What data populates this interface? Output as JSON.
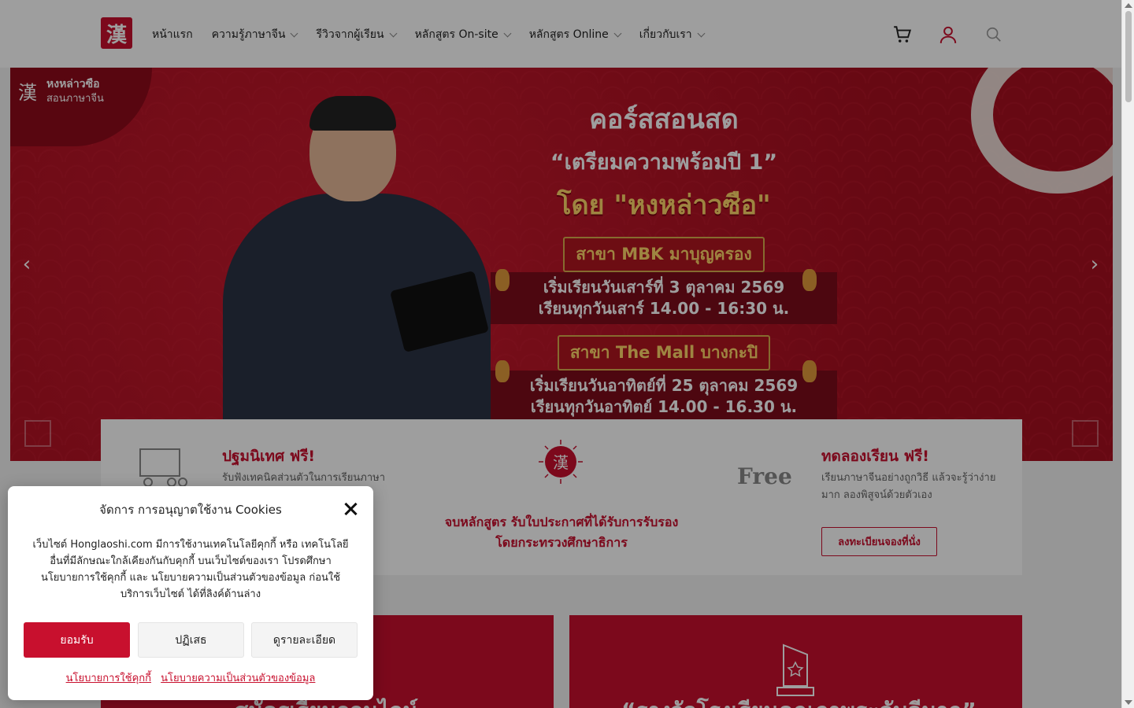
{
  "header": {
    "logo_glyph": "漢",
    "nav": [
      {
        "label": "หน้าแรก",
        "has_dropdown": false
      },
      {
        "label": "ความรู้ภาษาจีน",
        "has_dropdown": true
      },
      {
        "label": "รีวิวจากผู้เรียน",
        "has_dropdown": true
      },
      {
        "label": "หลักสูตร On-site",
        "has_dropdown": true
      },
      {
        "label": "หลักสูตร Online",
        "has_dropdown": true
      },
      {
        "label": "เกี่ยวกับเรา",
        "has_dropdown": true
      }
    ],
    "icons": [
      "cart-icon",
      "user-icon",
      "search-icon"
    ]
  },
  "hero": {
    "badge_name": "หงหล่าวซือ",
    "badge_sub": "สอนภาษาจีน",
    "title": "คอร์สสอนสด",
    "subtitle": "“เตรียมความพร้อมปี 1”",
    "by_line": "โดย \"หงหล่าวซือ\"",
    "branches": [
      {
        "name": "สาขา MBK มาบุญครอง",
        "line1": "เริ่มเรียนวันเสาร์ที่ 3 ตุลาคม 2569",
        "line2": "เรียนทุกวันเสาร์ 14.00 - 16:30 น."
      },
      {
        "name": "สาขา The Mall บางกะปิ",
        "line1": "เริ่มเรียนวันอาทิตย์ที่ 25 ตุลาคม 2569",
        "line2": "เรียนทุกวันอาทิตย์ 14.00 - 16.30 น."
      }
    ],
    "prev_arrow": "‹",
    "next_arrow": "›"
  },
  "features": {
    "left": {
      "title": "ปฐมนิเทศ ฟรี!",
      "desc": "รับฟังเทคนิคส่วนตัวในการเรียนภาษา"
    },
    "center": {
      "line1": "จบหลักสูตร รับใบประกาศที่ได้รับการรับรอง",
      "line2": "โดยกระทรวงศึกษาธิการ"
    },
    "right": {
      "title": "ทดลองเรียน ฟรี!",
      "desc1": "เรียนภาษาจีนอย่างถูกวิธี แล้วจะรู้ว่าง่าย",
      "desc2": "มาก ลองพิสูจน์ด้วยตัวเอง",
      "button": "ลงทะเบียนจองที่นั่ง",
      "free_label": "Free"
    }
  },
  "cards": {
    "left_text": "สมัครเรียนออนไลน์",
    "right_text": "“รางวัลโรงเรียนคุณภาพระดับดีมาก”"
  },
  "cookie": {
    "title": "จัดการ การอนุญาตใช้งาน Cookies",
    "body": "เว็บไซต์ Honglaoshi.com มีการใช้งานเทคโนโลยีคุกกี้ หรือ เทคโนโลยีอื่นที่มีลักษณะใกล้เคียงกันกับคุกกี้ บนเว็บไซต์ของเรา โปรดศึกษา นโยบายการใช้คุกกี้ และ นโยบายความเป็นส่วนตัวของข้อมูล ก่อนใช้บริการเว็บไซต์ ได้ที่ลิงค์ด้านล่าง",
    "accept": "ยอมรับ",
    "deny": "ปฏิเสธ",
    "details": "ดูรายละเอียด",
    "link_cookie": "นโยบายการใช้คุกกี้",
    "link_privacy": "นโยบายความเป็นส่วนตัวของข้อมูล"
  },
  "colors": {
    "brand": "#c8102e",
    "gold": "#ffd76a"
  }
}
